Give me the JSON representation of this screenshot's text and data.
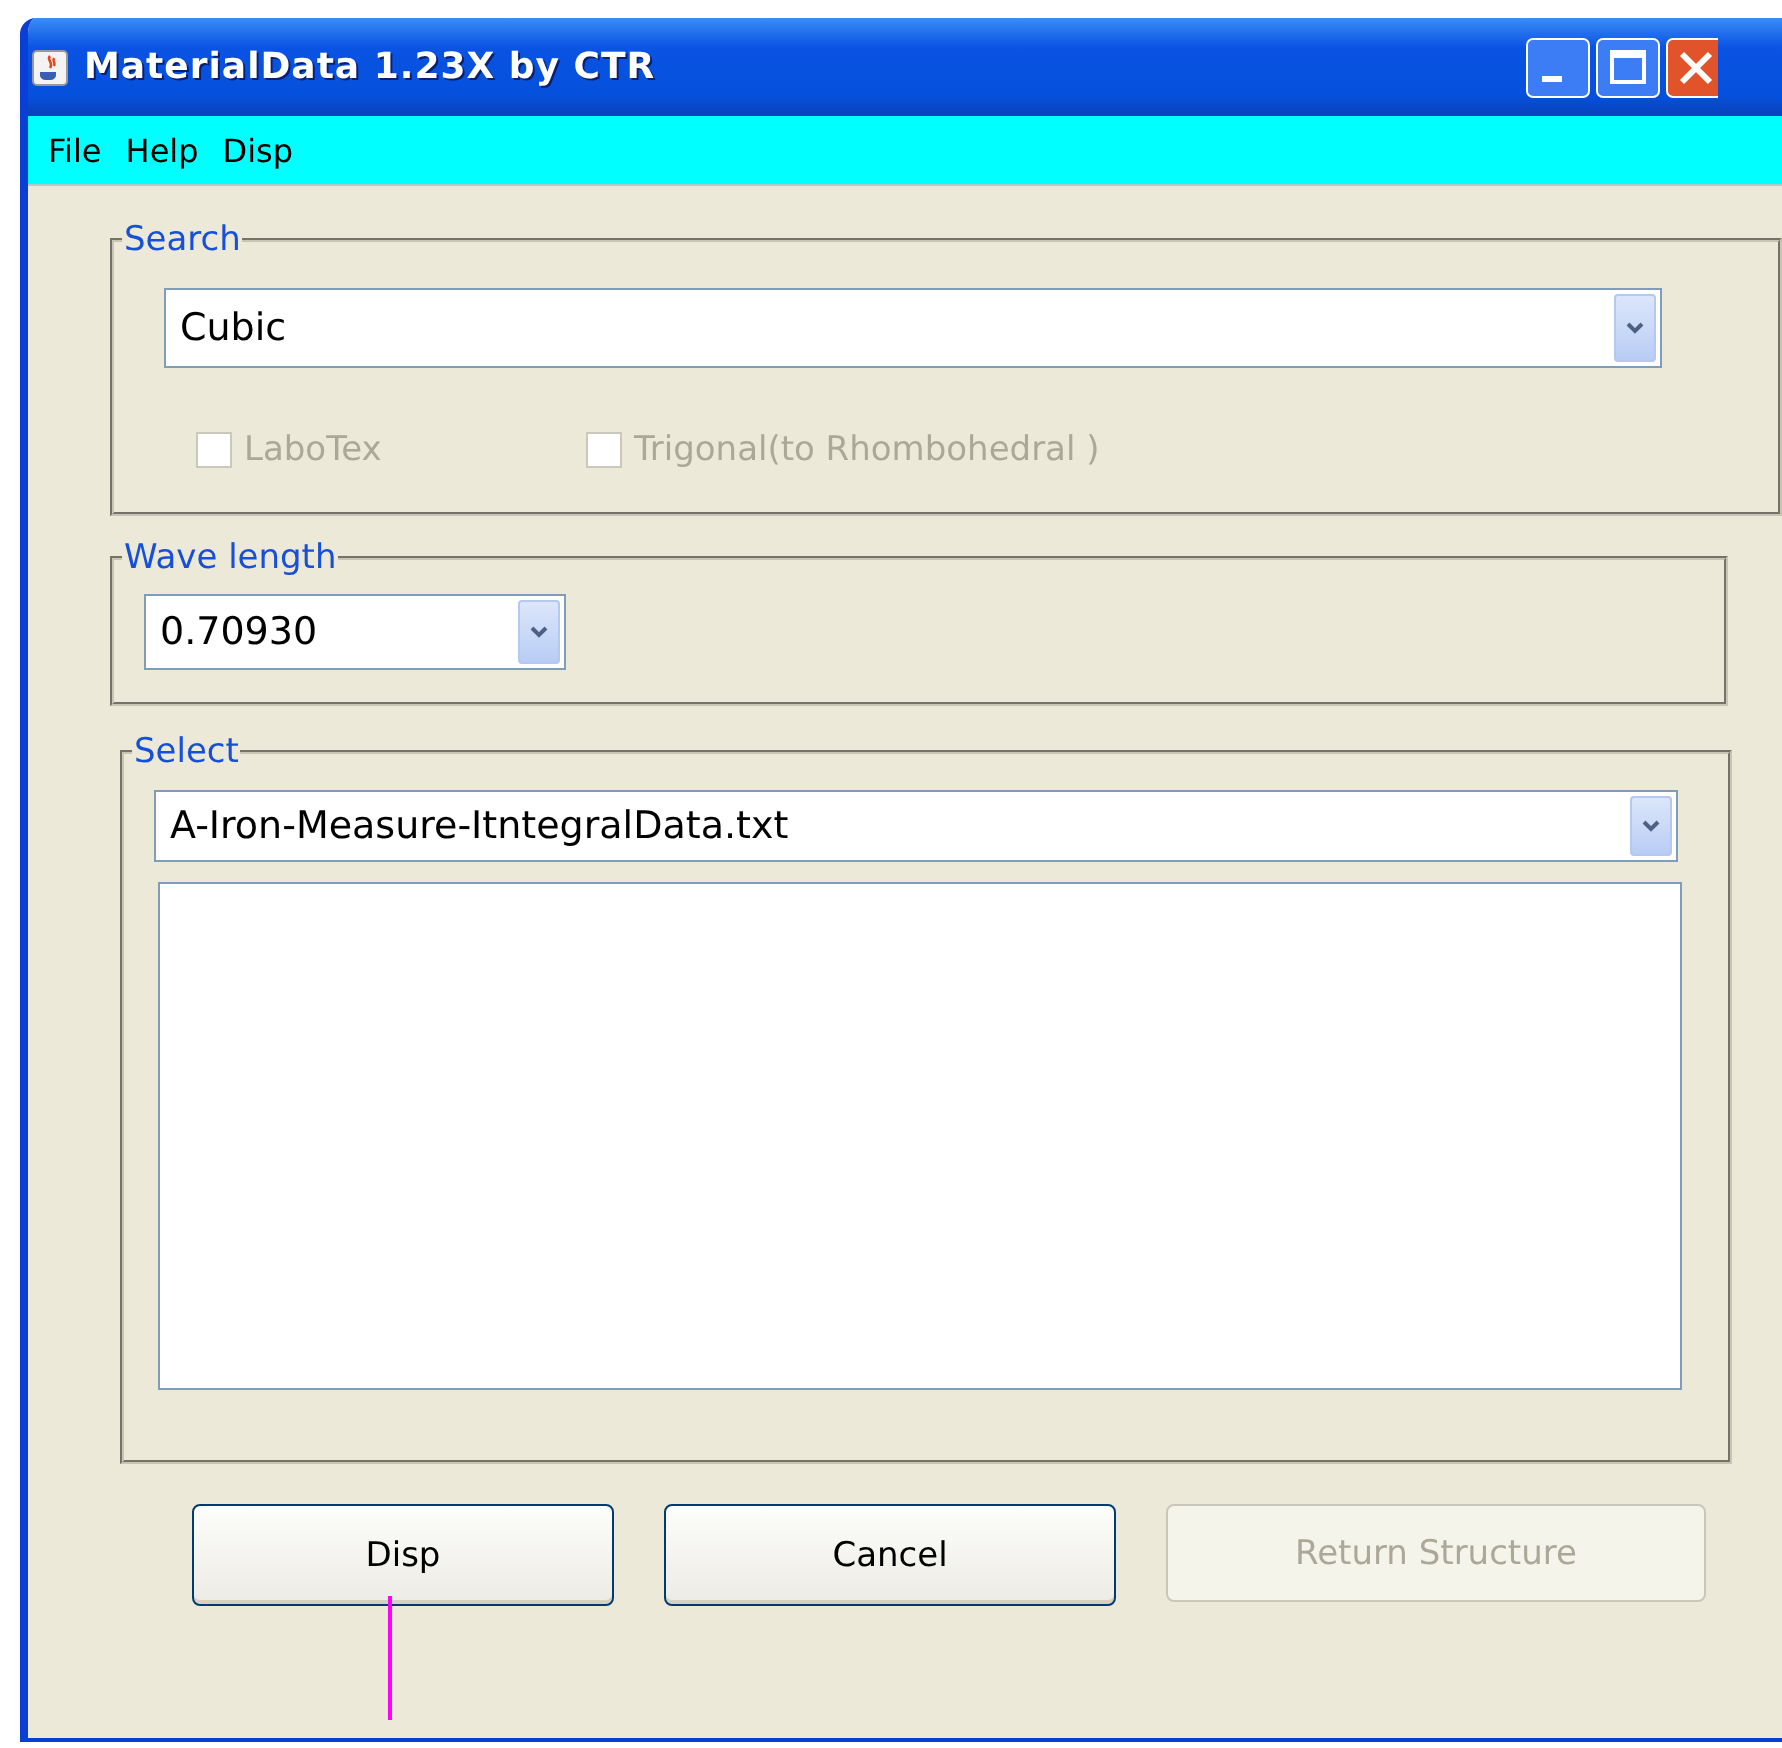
{
  "window": {
    "title": "MaterialData 1.23X by CTR"
  },
  "menu": [
    {
      "label": "File"
    },
    {
      "label": "Help"
    },
    {
      "label": "Disp"
    }
  ],
  "search": {
    "legend": "Search",
    "value": "Cubic",
    "options": [
      {
        "label": "LaboTex",
        "checked": false,
        "disabled": true
      },
      {
        "label": "Trigonal(to Rhombohedral )",
        "checked": false,
        "disabled": true
      }
    ]
  },
  "wave_length": {
    "legend": "Wave length",
    "value": "0.70930"
  },
  "select": {
    "legend": "Select",
    "value": "A-Iron-Measure-ItntegralData.txt"
  },
  "buttons": [
    {
      "label": "Disp",
      "disabled": false
    },
    {
      "label": "Cancel",
      "disabled": false
    },
    {
      "label": "Return Structure",
      "disabled": true
    }
  ]
}
